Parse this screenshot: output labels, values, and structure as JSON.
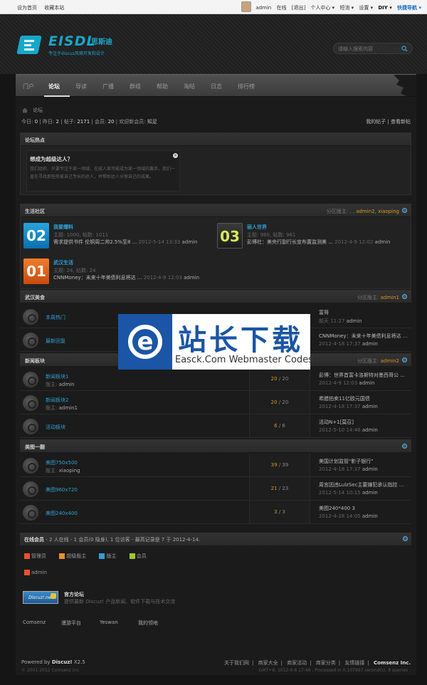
{
  "topbar": {
    "left": [
      "设为首页",
      "收藏本站"
    ],
    "user": "admin",
    "links": [
      "在线",
      "[退出]",
      "个人中心 ▾",
      "短消 ▾",
      "设置 ▾"
    ],
    "diy": "DIY ▾",
    "quick": "快捷导航 ▾"
  },
  "header": {
    "logo_text": "EISDL",
    "logo_cn": "思斯迪",
    "logo_tag": "专注于discuz风格开发和设计",
    "search_placeholder": "请输入搜索内容"
  },
  "nav": [
    "门户",
    "论坛",
    "导读",
    "广播",
    "群组",
    "帮助",
    "淘帖",
    "日志",
    "排行榜"
  ],
  "breadcrumb": "论坛",
  "stats": {
    "today_label": "今日:",
    "today": "0",
    "yesterday_label": "昨日:",
    "yesterday": "2",
    "posts_label": "帖子:",
    "posts": "2171",
    "members_label": "会员:",
    "members": "20",
    "newest_label": "欢迎新会员:",
    "newest": "知足",
    "mylinks": "我的帖子 | 查看新帖"
  },
  "hot": {
    "title": "论坛热点",
    "question": "想成为超级达人？",
    "desc": "我们组织、只要专注于某一领域，在成人某可能成为某一领域的赢手，我们一直在寻找那些热爱自己专长的达人，并帮助达人分享自己的成果。"
  },
  "life": {
    "title": "生活社区",
    "moderators": "分区版主: , ,",
    "moderators_names": "admin2, xiaoping",
    "forums": [
      {
        "num": "02",
        "name": "我要爆料",
        "meta": "主题: 1000, 帖数: 1011",
        "last": "需求提供书件 伦铜周二帅2.5%至8 ...",
        "date": "2012-5-14 13:33",
        "user": "admin"
      },
      {
        "num": "03",
        "name": "丽人世界",
        "meta": "主题: 980, 帖数: 981",
        "last": "彭博社：美央行副行长宣布置监测美 ...",
        "date": "2012-4-9 12:02",
        "user": "admin"
      },
      {
        "num": "01",
        "name": "武汉生活",
        "meta": "主题: 24, 帖数: 24",
        "last": "CNNMoney：未来十年美债利息将达 ...",
        "date": "2012-4-9 12:03",
        "user": "admin"
      }
    ]
  },
  "food": {
    "title": "武汉美食",
    "moderators": "分区版主:",
    "moderators_names": "admin1",
    "rows": [
      {
        "name": "本周热门",
        "last": "富哥",
        "when": "前天 11:27",
        "user": "admin"
      },
      {
        "name": "最新回复",
        "last": "CNNMoney：未来十年美债利息将达 ...",
        "when": "2012-4-18 17:37",
        "user": "admin"
      }
    ]
  },
  "news": {
    "title": "新闻板块",
    "moderators": "分区版主:",
    "moderators_names": "admin2",
    "rows": [
      {
        "name": "新闻板块1",
        "mod_label": "版主:",
        "mod": "admin",
        "today": "20",
        "total": "20",
        "last": "彭博：世界首富卡洛斯特对墨西哥公 ...",
        "when": "2012-4-9 12:03",
        "user": "admin"
      },
      {
        "name": "新闻板块2",
        "mod_label": "版主:",
        "mod": "admin1",
        "today": "20",
        "total": "20",
        "last": "希腊拍卖11亿欧元国债",
        "when": "2012-4-18 17:37",
        "user": "admin"
      },
      {
        "name": "活动板块",
        "mod_label": "",
        "mod": "",
        "today": "6",
        "total": "6",
        "last": "活动N+1[莫召]",
        "when": "2012-5-10 14:46",
        "user": "admin"
      }
    ]
  },
  "images": {
    "title": "美图一翻",
    "rows": [
      {
        "name": "美图750x500",
        "mod_label": "版主:",
        "mod": "xiaoping",
        "today": "39",
        "total": "39",
        "last": "美国计划监管\"影子银行\"",
        "when": "2012-4-18 17:37",
        "user": "admin"
      },
      {
        "name": "美图960x720",
        "mod_label": "",
        "mod": "",
        "today": "21",
        "total": "23",
        "last": "周言因违LulzSec主要嫌犯承认指控 ...",
        "when": "2012-5-14 10:15",
        "user": "admin"
      },
      {
        "name": "美图240x400",
        "mod_label": "",
        "mod": "",
        "today": "3",
        "total": "3",
        "last": "美图240*400 3",
        "when": "2012-4-28 14:05",
        "user": "admin"
      }
    ]
  },
  "online": {
    "title": "在线会员",
    "summary": "- 2 人在线 - 1 会员(0 隐身), 1 位访客 - 最高记录是 7 于 2012-4-14.",
    "legend": [
      {
        "label": "管理员",
        "color": "#e8522b"
      },
      {
        "label": "超级版主",
        "color": "#e8902b"
      },
      {
        "label": "版主",
        "color": "#2fa0d4"
      },
      {
        "label": "会员",
        "color": "#9acb2f"
      }
    ],
    "user": "admin"
  },
  "links": {
    "badge": "Discuz!.net",
    "title": "官方论坛",
    "desc": "提供最新 Discuz! 产品新闻、软件下载与技术交流",
    "text_links": [
      "Comsenz",
      "漫游平台",
      "Yeswan",
      "我的领地"
    ]
  },
  "footer": {
    "powered": "Powered by",
    "product": "Discuz!",
    "version": "X2.5",
    "copyright": "© 2001-2012 Comsenz Inc.",
    "links": [
      "关于我们网",
      "|",
      "商家大全",
      "|",
      "商家活动",
      "|",
      "商家分类",
      "|",
      "友情链接",
      "|"
    ],
    "inc": "Comsenz Inc.",
    "gmt": "GMT+8, 2012-6-8 17:48 , Processed in 0.107997 second(s), 8 queries ."
  },
  "watermark": {
    "cn": "站长下载",
    "en": "Easck.Com Webmaster Codes"
  },
  "colors": {
    "accent": "#2fa0d4",
    "highlight": "#d99622"
  }
}
